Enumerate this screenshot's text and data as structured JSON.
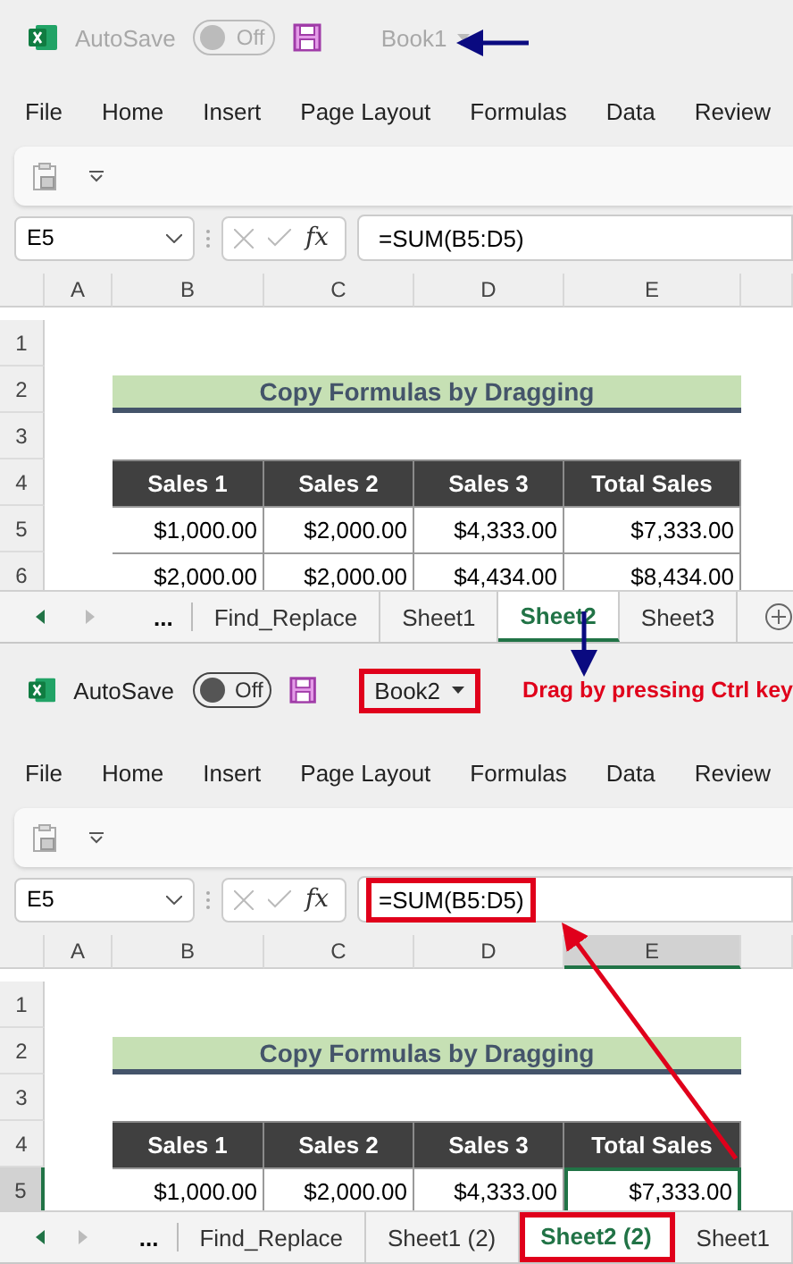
{
  "windows": [
    {
      "active": false,
      "autosave": {
        "label": "AutoSave",
        "state": "Off"
      },
      "book": {
        "name": "Book1",
        "highlighted": false
      },
      "menu": [
        "File",
        "Home",
        "Insert",
        "Page Layout",
        "Formulas",
        "Data",
        "Review"
      ],
      "name_box": "E5",
      "function_label": "fx",
      "formula": {
        "text": "=SUM(B5:D5)",
        "highlighted": false
      },
      "columns": [
        "A",
        "B",
        "C",
        "D",
        "E"
      ],
      "row_numbers": [
        "1",
        "2",
        "3",
        "4",
        "5",
        "6"
      ],
      "selection_visible": false,
      "title_cell": "Copy Formulas by Dragging",
      "headers": [
        "Sales 1",
        "Sales 2",
        "Sales 3",
        "Total Sales"
      ],
      "rows": [
        [
          "",
          "$1,000.00",
          "$2,000.00",
          "$4,333.00",
          "$7,333.00"
        ],
        [
          "",
          "$2,000.00",
          "$2,000.00",
          "$4,434.00",
          "$8,434.00"
        ]
      ],
      "tabs_overflow": "...",
      "tabs": [
        {
          "label": "Find_Replace",
          "selected": false,
          "highlighted": false
        },
        {
          "label": "Sheet1",
          "selected": false,
          "highlighted": false
        },
        {
          "label": "Sheet2",
          "selected": true,
          "highlighted": false
        },
        {
          "label": "Sheet3",
          "selected": false,
          "highlighted": false
        }
      ],
      "add_sheet": true
    },
    {
      "active": true,
      "autosave": {
        "label": "AutoSave",
        "state": "Off"
      },
      "book": {
        "name": "Book2",
        "highlighted": true
      },
      "note": "Drag by pressing Ctrl key",
      "menu": [
        "File",
        "Home",
        "Insert",
        "Page Layout",
        "Formulas",
        "Data",
        "Review"
      ],
      "name_box": "E5",
      "function_label": "fx",
      "formula": {
        "text": "=SUM(B5:D5)",
        "highlighted": true
      },
      "columns": [
        "A",
        "B",
        "C",
        "D",
        "E"
      ],
      "row_numbers": [
        "1",
        "2",
        "3",
        "4",
        "5"
      ],
      "selection_visible": true,
      "title_cell": "Copy Formulas by Dragging",
      "headers": [
        "Sales 1",
        "Sales 2",
        "Sales 3",
        "Total Sales"
      ],
      "rows": [
        [
          "",
          "$1,000.00",
          "$2,000.00",
          "$4,333.00",
          "$7,333.00"
        ]
      ],
      "tabs_overflow": "...",
      "tabs": [
        {
          "label": "Find_Replace",
          "selected": false,
          "highlighted": false
        },
        {
          "label": "Sheet1 (2)",
          "selected": false,
          "highlighted": false
        },
        {
          "label": "Sheet2 (2)",
          "selected": true,
          "highlighted": true
        },
        {
          "label": "Sheet1",
          "selected": false,
          "highlighted": false
        }
      ],
      "add_sheet": false
    }
  ]
}
